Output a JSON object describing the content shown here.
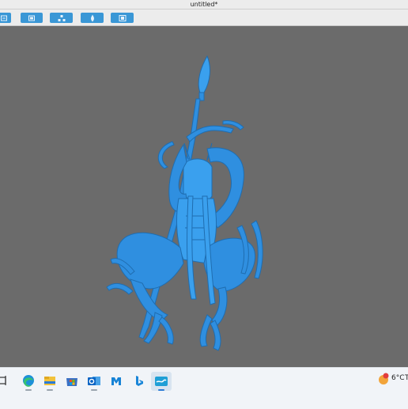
{
  "window": {
    "title": "untitled*"
  },
  "toolbar": {
    "buttons": [
      {
        "icon": "import-icon"
      },
      {
        "icon": "window-icon"
      },
      {
        "icon": "network-icon"
      },
      {
        "icon": "drop-icon"
      },
      {
        "icon": "frame-icon"
      }
    ]
  },
  "viewport": {
    "model_color": "#2f8fe0",
    "background": "#6b6b6b"
  },
  "taskbar": {
    "apps": [
      {
        "icon": "task-view-icon"
      },
      {
        "icon": "edge-browser-icon"
      },
      {
        "icon": "file-explorer-icon"
      },
      {
        "icon": "microsoft-store-icon"
      },
      {
        "icon": "outlook-icon"
      },
      {
        "icon": "m-app-icon"
      },
      {
        "icon": "bing-icon"
      },
      {
        "icon": "slicer-app-icon"
      }
    ],
    "weather": {
      "temperature": "6°C",
      "extra": "T"
    }
  }
}
